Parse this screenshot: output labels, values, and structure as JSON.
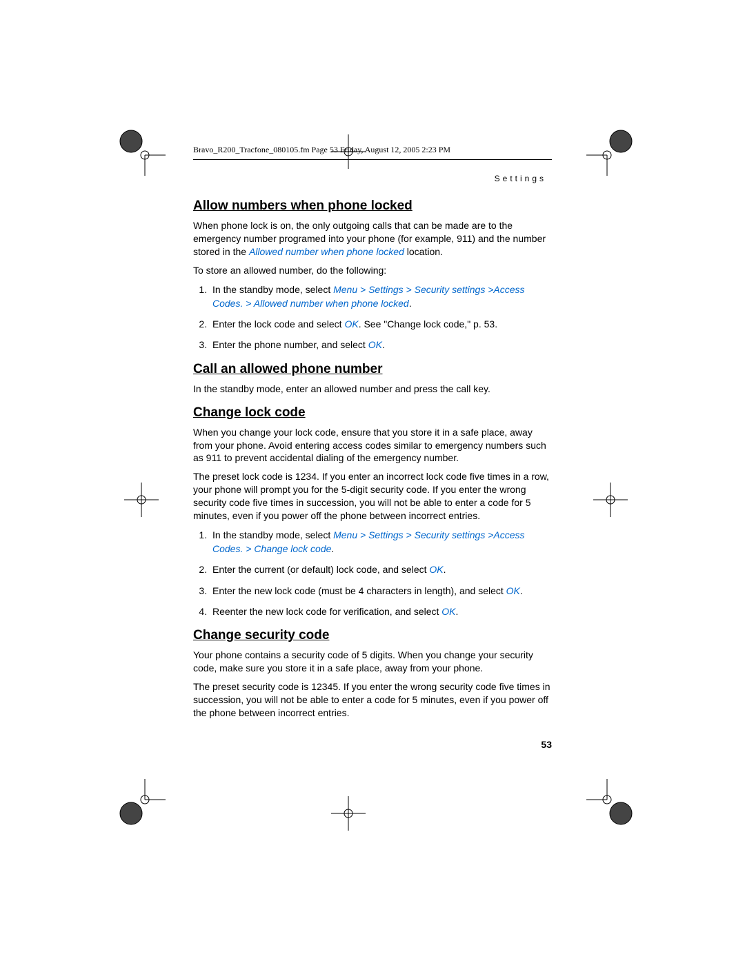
{
  "header": "Bravo_R200_Tracfone_080105.fm  Page 53  Friday, August 12, 2005  2:23 PM",
  "section_label": "Settings",
  "s1": {
    "title": "Allow numbers when phone locked",
    "p1a": "When phone lock is on, the only outgoing calls that can be made are to the emergency number programed into your phone (for example, 911) and the number stored in the ",
    "p1_link": "Allowed number when phone locked",
    "p1b": " location.",
    "p2": "To store an allowed number, do the following:",
    "li1a": "In the standby mode, select ",
    "li1_path": "Menu > Settings > Security settings >Access Codes. > Allowed number when phone locked",
    "li1b": ".",
    "li2a": "Enter the lock code and select ",
    "li2_ok": "OK",
    "li2b": ". See \"Change lock code,\" p. 53.",
    "li3a": "Enter the phone number, and select ",
    "li3_ok": "OK",
    "li3b": "."
  },
  "s2": {
    "title": "Call an allowed phone number",
    "p1": "In the standby mode, enter an allowed number and press the call key."
  },
  "s3": {
    "title": "Change lock code",
    "p1": "When you change your lock code, ensure that you store it in a safe place, away from your phone. Avoid entering access codes similar to emergency numbers such as 911 to prevent accidental dialing of the emergency number.",
    "p2": "The preset lock code is 1234. If you enter an incorrect lock code five times in a row, your phone will prompt you for the 5-digit security code. If you enter the wrong security code five times in succession, you will not be able to enter a code for 5 minutes, even if you power off the phone between incorrect entries.",
    "li1a": "In the standby mode, select ",
    "li1_path": "Menu > Settings > Security settings >Access Codes. > Change lock code",
    "li1b": ".",
    "li2a": "Enter the current (or default) lock code, and select ",
    "li2_ok": "OK",
    "li2b": ".",
    "li3a": "Enter the new lock code (must be 4 characters in length), and select ",
    "li3_ok": "OK",
    "li3b": ".",
    "li4a": "Reenter the new lock code for verification, and select ",
    "li4_ok": "OK",
    "li4b": "."
  },
  "s4": {
    "title": "Change security code",
    "p1": "Your phone contains a security code of 5 digits. When you change your security code, make sure you store it in a safe place, away from your phone.",
    "p2": "The preset security code is 12345. If you enter the wrong security code five times in succession, you will not be able to enter a code for 5 minutes, even if you power off the phone between incorrect entries."
  },
  "page_number": "53"
}
